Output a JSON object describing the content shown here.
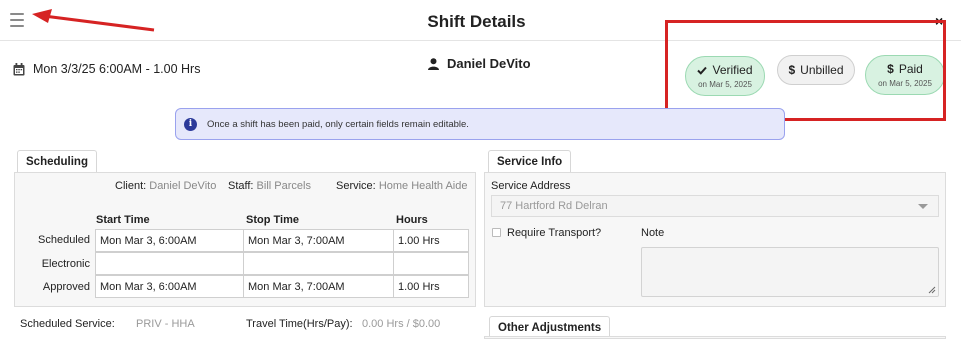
{
  "header": {
    "title": "Shift Details",
    "close_label": "×",
    "menu_icon": "hamburger-icon"
  },
  "shift": {
    "datetime": "Mon 3/3/25 6:00AM - 1.00 Hrs",
    "person": "Daniel DeVito"
  },
  "status_pills": [
    {
      "label": "Verified",
      "icon": "check-icon",
      "sub": "on Mar 5, 2025",
      "color": "#d8f2e1"
    },
    {
      "label": "Unbilled",
      "icon": "dollar-icon",
      "sub": "",
      "color": "#f1f1f1"
    },
    {
      "label": "Paid",
      "icon": "dollar-icon",
      "sub": "on Mar 5, 2025",
      "color": "#d8f2e1"
    }
  ],
  "info_banner": {
    "text": "Once a shift has been paid, only certain fields remain editable."
  },
  "scheduling": {
    "tab_label": "Scheduling",
    "client_label": "Client:",
    "client_value": "Daniel DeVito",
    "staff_label": "Staff:",
    "staff_value": "Bill Parcels",
    "service_label": "Service:",
    "service_value": "Home Health Aide",
    "columns": [
      "Start Time",
      "Stop Time",
      "Hours"
    ],
    "rows": [
      {
        "label": "Scheduled",
        "start": "Mon Mar 3, 6:00AM",
        "stop": "Mon Mar 3, 7:00AM",
        "hours": "1.00 Hrs"
      },
      {
        "label": "Electronic",
        "start": "",
        "stop": "",
        "hours": ""
      },
      {
        "label": "Approved",
        "start": "Mon Mar 3, 6:00AM",
        "stop": "Mon Mar 3, 7:00AM",
        "hours": "1.00 Hrs"
      }
    ],
    "scheduled_service_label": "Scheduled Service:",
    "scheduled_service_value": "PRIV - HHA",
    "travel_label": "Travel Time(Hrs/Pay):",
    "travel_value": "0.00 Hrs / $0.00"
  },
  "service_info": {
    "tab_label": "Service Info",
    "address_label": "Service Address",
    "address_value": "77 Hartford Rd Delran",
    "transport_label": "Require Transport?",
    "note_label": "Note"
  },
  "other_adjustments": {
    "tab_label": "Other Adjustments"
  },
  "colors": {
    "annotation_red": "#d62323",
    "banner_bg": "#e6e8fb",
    "pill_green": "#d8f2e1"
  }
}
